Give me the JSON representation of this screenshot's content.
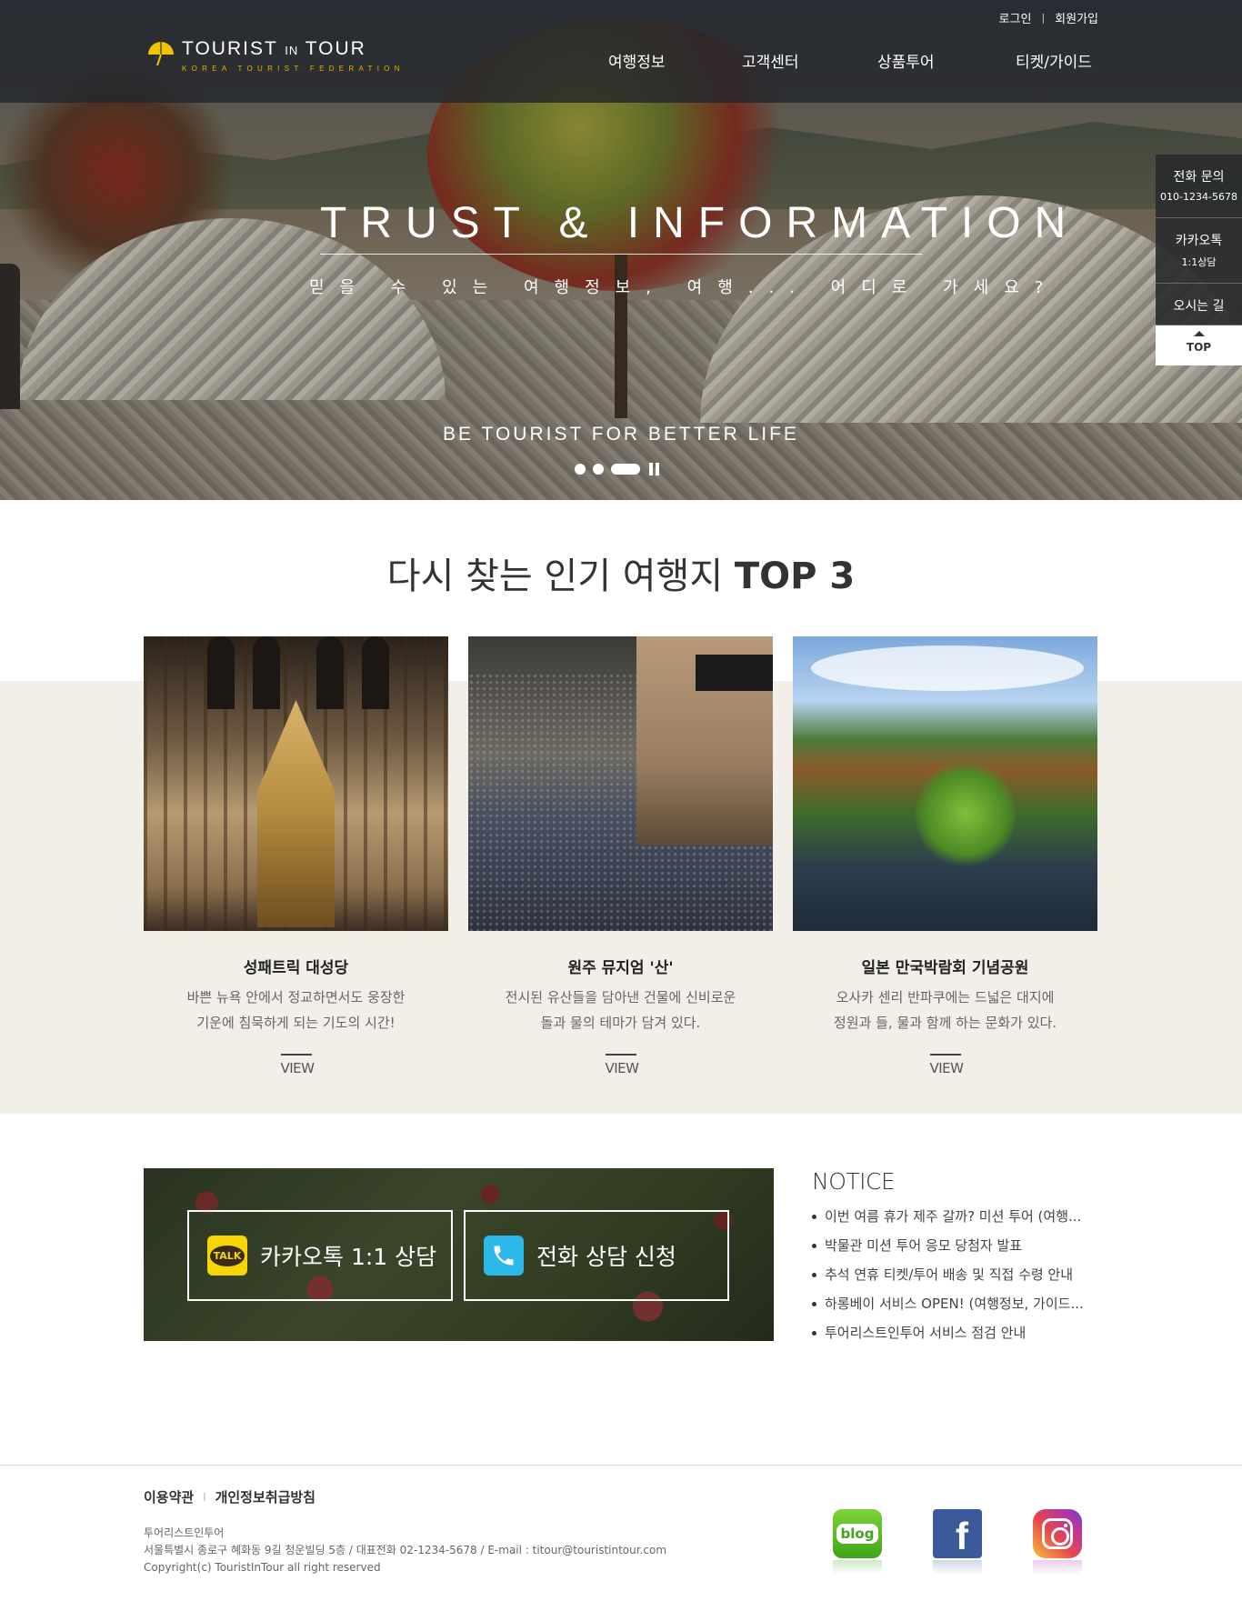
{
  "header": {
    "logo": {
      "title_a": "TOURIST",
      "title_in": "IN",
      "title_b": "TOUR",
      "subtitle": "KOREA TOURIST FEDERATION"
    },
    "util": {
      "login": "로그인",
      "signup": "회원가입"
    },
    "nav": [
      "여행정보",
      "고객센터",
      "상품투어",
      "티켓/가이드"
    ]
  },
  "hero": {
    "title": "TRUST & INFORMATION",
    "subtitle": "믿을 수 있는 여행정보, 여행... 어디로 가세요?",
    "slogan": "BE TOURIST FOR BETTER LIFE",
    "slides_total": 3,
    "slide_active": 3
  },
  "quick_menu": {
    "phone_label": "전화 문의",
    "phone_number": "010-1234-5678",
    "kakao_label": "카카오톡",
    "kakao_sub": "1:1상담",
    "directions": "오시는 길",
    "top": "TOP"
  },
  "top3": {
    "title_plain": "다시 찾는 인기 여행지 ",
    "title_bold": "TOP 3",
    "cards": [
      {
        "title": "성패트릭 대성당",
        "desc1": "바쁜 뉴욕 안에서 정교하면서도 웅장한",
        "desc2": "기운에 침묵하게 되는 기도의 시간!",
        "view": "VIEW"
      },
      {
        "title": "원주 뮤지엄 '산'",
        "desc1": "전시된 유산들을 담아낸 건물에 신비로운",
        "desc2": "돌과 물의 테마가 담겨 있다.",
        "view": "VIEW"
      },
      {
        "title": "일본 만국박람회 기념공원",
        "desc1": "오사카 센리 반파쿠에는 드넓은 대지에",
        "desc2": "정원과 들, 물과 함께 하는 문화가 있다.",
        "view": "VIEW"
      }
    ]
  },
  "consult": {
    "kakao_icon_text": "TALK",
    "kakao": "카카오톡 1:1 상담",
    "phone": "전화 상담 신청"
  },
  "notice": {
    "title": "NOTICE",
    "items": [
      "이번 여름 휴가 제주 갈까? 미션 투어 (여행...",
      "박물관 미션 투어 응모 당첨자 발표",
      "추석 연휴 티켓/투어 배송 및 직접 수령 안내",
      "하롱베이 서비스 OPEN! (여행정보, 가이드...",
      "투어리스트인투어 서비스 점검 안내"
    ]
  },
  "footer": {
    "terms": "이용약관",
    "privacy": "개인정보취급방침",
    "company": "투어리스트인투어",
    "address": "서울특별시 종로구 혜화동 9길 청운빌딩 5층 / 대표전화 02-1234-5678 / E-mail : titour@touristintour.com",
    "copyright": "Copyright(c) TouristInTour all right reserved",
    "social": {
      "blog": "blog",
      "facebook": "f"
    }
  },
  "colors": {
    "accent": "#e9b000",
    "beige": "#f2eee8",
    "kakao": "#f6d500",
    "phone": "#2cb8e8"
  }
}
